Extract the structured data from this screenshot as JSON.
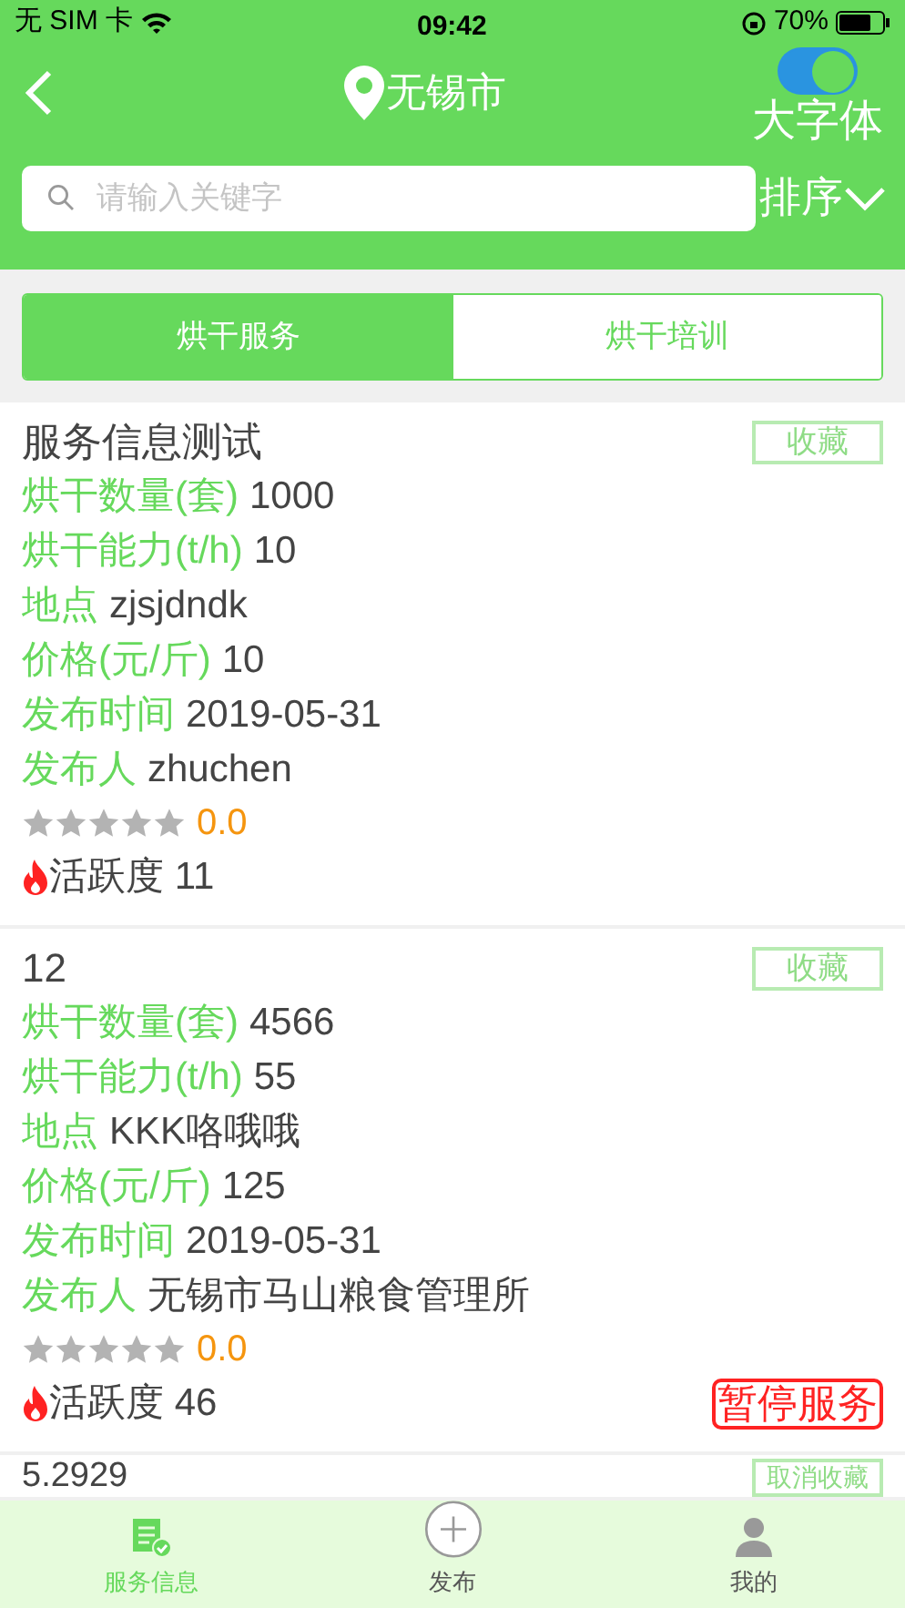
{
  "status_bar": {
    "carrier": "无 SIM 卡",
    "time": "09:42",
    "battery": "70%"
  },
  "header": {
    "city": "无锡市",
    "large_font": {
      "label": "大字体",
      "on": true
    },
    "search": {
      "placeholder": "请输入关键字"
    },
    "sort": "排序"
  },
  "tabs": [
    {
      "label": "烘干服务",
      "selected": true
    },
    {
      "label": "烘干培训",
      "selected": false
    }
  ],
  "cards": [
    {
      "title": "服务信息测试",
      "favorite": "收藏",
      "fields": [
        {
          "label": "烘干数量(套)",
          "value": "1000"
        },
        {
          "label": "烘干能力(t/h)",
          "value": "10"
        },
        {
          "label": "地点",
          "value": "zjsjdndk"
        },
        {
          "label": "价格(元/斤)",
          "value": "10"
        },
        {
          "label": "发布时间",
          "value": "2019-05-31"
        },
        {
          "label": "发布人",
          "value": "zhuchen"
        }
      ],
      "stars": 0,
      "rating": "0.0",
      "activity_label": "活跃度",
      "activity": "11"
    },
    {
      "title": "12",
      "favorite": "收藏",
      "fields": [
        {
          "label": "烘干数量(套)",
          "value": "4566"
        },
        {
          "label": "烘干能力(t/h)",
          "value": "55"
        },
        {
          "label": "地点",
          "value": "KKK咯哦哦"
        },
        {
          "label": "价格(元/斤)",
          "value": "125"
        },
        {
          "label": "发布时间",
          "value": "2019-05-31"
        },
        {
          "label": "发布人",
          "value": "无锡市马山粮食管理所"
        }
      ],
      "stars": 0,
      "rating": "0.0",
      "activity_label": "活跃度",
      "activity": "46",
      "action": "暂停服务"
    },
    {
      "title": "5.2929",
      "favorite": "取消收藏"
    }
  ],
  "tab_bar": [
    {
      "label": "服务信息",
      "kind": "info",
      "selected": true
    },
    {
      "label": "发布",
      "kind": "add",
      "selected": false
    },
    {
      "label": "我的",
      "kind": "user",
      "selected": false
    }
  ]
}
